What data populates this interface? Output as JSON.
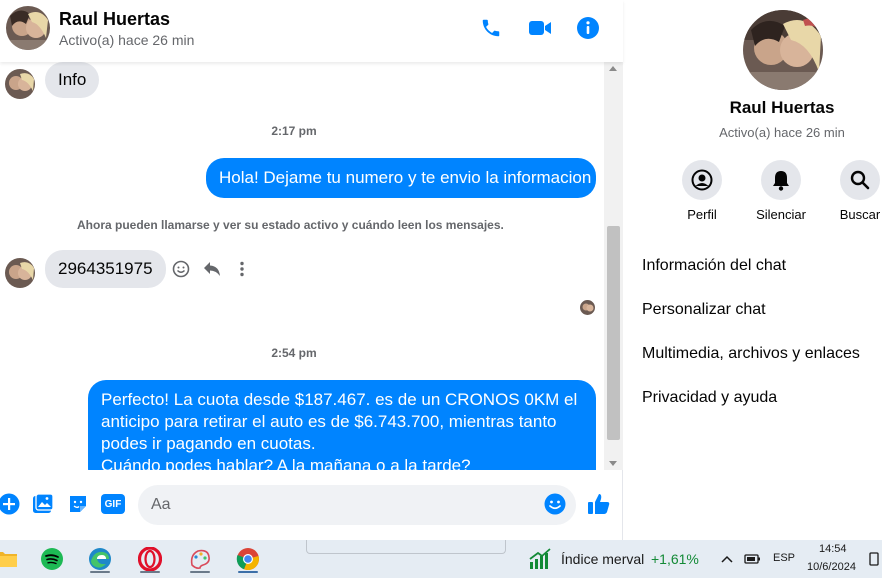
{
  "header": {
    "name": "Raul Huertas",
    "status": "Activo(a) hace 26 min",
    "icons": [
      "phone-icon",
      "video-icon",
      "info-icon"
    ]
  },
  "messages": {
    "info_bubble": "Info",
    "time_1": "2:17 pm",
    "out_1": "Hola! Dejame tu numero y te envio la informacion",
    "notice": "Ahora pueden llamarse y ver su estado activo y cuándo leen los mensajes.",
    "in_phone": "2964351975",
    "time_2": "2:54 pm",
    "out_2_lines": [
      "Perfecto! La cuota desde $187.467. es de un CRONOS 0KM el",
      "anticipo para retirar el auto es de $6.743.700, mientras tanto",
      "podes ir pagando en cuotas.",
      "Cuándo podes hablar? A la mañana o a la tarde?"
    ]
  },
  "composer": {
    "placeholder": "Aa",
    "icons": [
      "plus-icon",
      "gallery-icon",
      "sticker-icon",
      "gif-icon",
      "emoji-icon",
      "like-icon"
    ],
    "gif_label": "GIF"
  },
  "panel": {
    "name": "Raul Huertas",
    "status": "Activo(a) hace 26 min",
    "actions": [
      {
        "label": "Perfil",
        "icon": "profile-icon"
      },
      {
        "label": "Silenciar",
        "icon": "bell-icon"
      },
      {
        "label": "Buscar",
        "icon": "search-icon"
      }
    ],
    "menu": [
      "Información del chat",
      "Personalizar chat",
      "Multimedia, archivos y enlaces",
      "Privacidad y ayuda"
    ]
  },
  "taskbar": {
    "apps": [
      "file-explorer-icon",
      "spotify-icon",
      "edge-icon",
      "opera-icon",
      "paint-icon",
      "chrome-icon"
    ],
    "stock_name": "Índice merval",
    "stock_change": "+1,61%",
    "language": "ESP",
    "time": "14:54",
    "date": "10/6/2024"
  },
  "colors": {
    "messenger_blue": "#0084ff",
    "bubble_gray": "#e4e6eb",
    "stock_green": "#138a36"
  }
}
